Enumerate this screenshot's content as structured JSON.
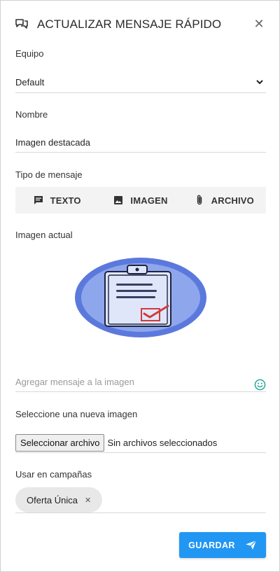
{
  "dialog": {
    "title": "ACTUALIZAR MENSAJE RÁPIDO",
    "close_icon": "close-icon",
    "header_icon": "chat-bubbles-icon"
  },
  "team": {
    "label": "Equipo",
    "value": "Default"
  },
  "name": {
    "label": "Nombre",
    "value": "Imagen destacada"
  },
  "message_type": {
    "label": "Tipo de mensaje",
    "tabs": [
      {
        "label": "TEXTO",
        "icon": "message-icon"
      },
      {
        "label": "IMAGEN",
        "icon": "image-icon"
      },
      {
        "label": "ARCHIVO",
        "icon": "paperclip-icon"
      }
    ]
  },
  "current_image": {
    "label": "Imagen actual"
  },
  "image_message": {
    "placeholder": "Agregar mensaje a la imagen"
  },
  "new_image": {
    "label": "Seleccione una nueva imagen",
    "button_label": "Seleccionar archivo",
    "status": "Sin archivos seleccionados"
  },
  "campaigns": {
    "label": "Usar en campañas",
    "chips": [
      {
        "label": "Oferta Única"
      }
    ]
  },
  "actions": {
    "save_label": "GUARDAR"
  },
  "colors": {
    "primary": "#2196f3",
    "emoji": "#26a69a"
  }
}
